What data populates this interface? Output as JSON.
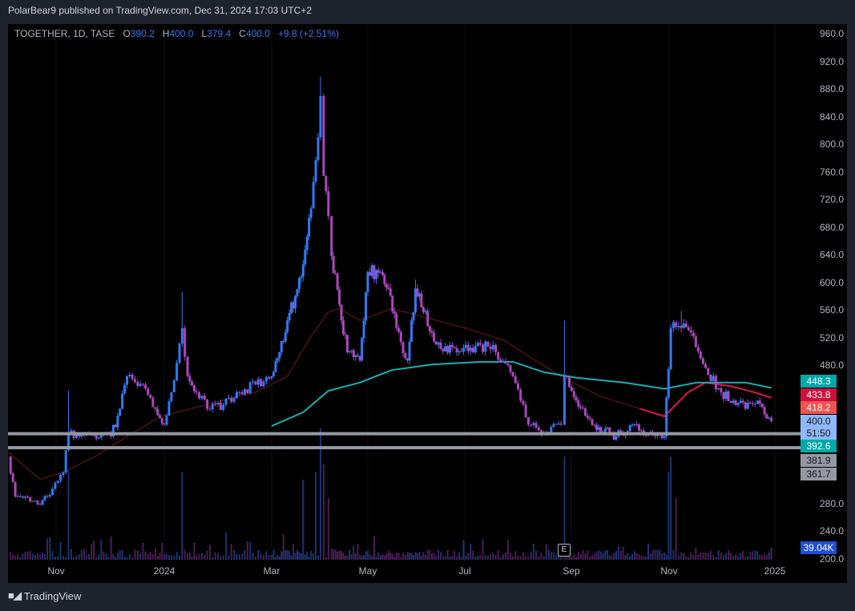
{
  "header": {
    "published": "PolarBear9 published on TradingView.com, Dec 31, 2024 17:03 UTC+2"
  },
  "legend": {
    "symbol": "TOGETHER, 1D, TASE",
    "o_label": "O",
    "o": "390.2",
    "h_label": "H",
    "h": "400.0",
    "l_label": "L",
    "l": "379.4",
    "c_label": "C",
    "c": "400.0",
    "change": "+9.8 (+2.51%)"
  },
  "price_scale": [
    "960.0",
    "920.0",
    "880.0",
    "840.0",
    "800.0",
    "760.0",
    "720.0",
    "680.0",
    "640.0",
    "600.0",
    "560.0",
    "520.0",
    "480.0",
    "280.0",
    "240.0",
    "200.0"
  ],
  "price_tags": [
    {
      "text": "448.3",
      "bg": "#00a8a8",
      "fg": "#ffffff"
    },
    {
      "text": "433.8",
      "bg": "#d0103c",
      "fg": "#ffffff"
    },
    {
      "text": "418.2",
      "bg": "#f05350",
      "fg": "#ffffff"
    },
    {
      "text": "400.0",
      "bg": "#8fb8f8",
      "fg": "#131722"
    },
    {
      "text": "51:50",
      "bg": "#8fb8f8",
      "fg": "#131722"
    },
    {
      "text": "392.6",
      "bg": "#00a8a8",
      "fg": "#ffffff"
    },
    {
      "text": "381.9",
      "bg": "#9598a1",
      "fg": "#131722"
    },
    {
      "text": "361.7",
      "bg": "#9598a1",
      "fg": "#131722"
    },
    {
      "text": "39.04K",
      "bg": "#1e4fd6",
      "fg": "#ffffff"
    }
  ],
  "x_axis": [
    {
      "label": "Nov",
      "date": "2023-11-01"
    },
    {
      "label": "2024",
      "date": "2024-01-01"
    },
    {
      "label": "Mar",
      "date": "2024-03-01"
    },
    {
      "label": "May",
      "date": "2024-05-01"
    },
    {
      "label": "Jul",
      "date": "2024-07-01"
    },
    {
      "label": "Sep",
      "date": "2024-09-01"
    },
    {
      "label": "Nov",
      "date": "2024-11-01"
    },
    {
      "label": "2025",
      "date": "2025-01-01"
    }
  ],
  "earnings_marker": "E",
  "branding": {
    "logo_text": "TradingView",
    "logo_mark": "TV"
  },
  "colors": {
    "up": "#3179f5",
    "down": "#ab47bc",
    "ma_long": "#17b0b8",
    "ma_mid_early": "#4a1414",
    "ma_mid_late": "#e0154b",
    "hline": "#9598a1",
    "vol_up": "#1c3272",
    "vol_down": "#4a1d55"
  },
  "chart_data": {
    "type": "candlestick",
    "title": "TOGETHER, 1D, TASE",
    "ylim": [
      200,
      960
    ],
    "closes": [
      [
        "2023-10-05",
        349
      ],
      [
        "2023-10-09",
        291
      ],
      [
        "2023-10-23",
        279
      ],
      [
        "2023-10-27",
        291
      ],
      [
        "2023-11-05",
        326
      ],
      [
        "2023-11-08",
        384
      ],
      [
        "2023-11-14",
        378
      ],
      [
        "2023-12-02",
        378
      ],
      [
        "2023-12-07",
        418
      ],
      [
        "2023-12-11",
        465
      ],
      [
        "2023-12-20",
        453
      ],
      [
        "2023-12-27",
        418
      ],
      [
        "2024-01-01",
        395
      ],
      [
        "2024-01-05",
        442
      ],
      [
        "2024-01-11",
        535
      ],
      [
        "2024-01-14",
        465
      ],
      [
        "2024-01-19",
        442
      ],
      [
        "2024-01-25",
        418
      ],
      [
        "2024-02-03",
        424
      ],
      [
        "2024-02-12",
        442
      ],
      [
        "2024-02-21",
        453
      ],
      [
        "2024-03-01",
        465
      ],
      [
        "2024-03-06",
        500
      ],
      [
        "2024-03-11",
        546
      ],
      [
        "2024-03-16",
        581
      ],
      [
        "2024-03-21",
        627
      ],
      [
        "2024-03-26",
        708
      ],
      [
        "2024-03-29",
        778
      ],
      [
        "2024-04-01",
        871
      ],
      [
        "2024-04-03",
        755
      ],
      [
        "2024-04-06",
        697
      ],
      [
        "2024-04-08",
        639
      ],
      [
        "2024-04-13",
        569
      ],
      [
        "2024-04-18",
        500
      ],
      [
        "2024-04-26",
        488
      ],
      [
        "2024-05-01",
        616
      ],
      [
        "2024-05-09",
        616
      ],
      [
        "2024-05-14",
        592
      ],
      [
        "2024-05-19",
        535
      ],
      [
        "2024-05-26",
        488
      ],
      [
        "2024-05-31",
        592
      ],
      [
        "2024-06-05",
        558
      ],
      [
        "2024-06-13",
        511
      ],
      [
        "2024-06-26",
        500
      ],
      [
        "2024-07-10",
        511
      ],
      [
        "2024-07-19",
        500
      ],
      [
        "2024-07-29",
        465
      ],
      [
        "2024-08-07",
        395
      ],
      [
        "2024-08-16",
        384
      ],
      [
        "2024-08-26",
        395
      ],
      [
        "2024-08-28",
        465
      ],
      [
        "2024-09-04",
        430
      ],
      [
        "2024-09-14",
        395
      ],
      [
        "2024-09-29",
        378
      ],
      [
        "2024-10-09",
        395
      ],
      [
        "2024-10-19",
        384
      ],
      [
        "2024-10-29",
        378
      ],
      [
        "2024-11-02",
        535
      ],
      [
        "2024-11-08",
        535
      ],
      [
        "2024-11-15",
        523
      ],
      [
        "2024-11-22",
        477
      ],
      [
        "2024-12-01",
        442
      ],
      [
        "2024-12-15",
        418
      ],
      [
        "2024-12-22",
        430
      ],
      [
        "2024-12-30",
        400
      ]
    ],
    "wick_highs": [
      [
        "2023-11-08",
        444
      ],
      [
        "2024-01-11",
        587
      ],
      [
        "2024-04-01",
        899
      ],
      [
        "2024-08-28",
        546
      ],
      [
        "2024-11-08",
        560
      ],
      [
        "2024-05-31",
        605
      ]
    ],
    "ma_long": [
      [
        "2024-03-01",
        393
      ],
      [
        "2024-03-21",
        413
      ],
      [
        "2024-04-06",
        444
      ],
      [
        "2024-04-26",
        456
      ],
      [
        "2024-05-16",
        474
      ],
      [
        "2024-06-10",
        482
      ],
      [
        "2024-07-10",
        486
      ],
      [
        "2024-07-29",
        486
      ],
      [
        "2024-08-16",
        471
      ],
      [
        "2024-09-04",
        463
      ],
      [
        "2024-10-04",
        456
      ],
      [
        "2024-10-29",
        447
      ],
      [
        "2024-11-17",
        456
      ],
      [
        "2024-12-15",
        456
      ],
      [
        "2024-12-30",
        448.3
      ]
    ],
    "ma_mid": [
      [
        "2023-10-05",
        355
      ],
      [
        "2023-10-23",
        316
      ],
      [
        "2023-11-05",
        326
      ],
      [
        "2023-11-23",
        349
      ],
      [
        "2023-12-11",
        378
      ],
      [
        "2023-12-30",
        407
      ],
      [
        "2024-01-25",
        424
      ],
      [
        "2024-02-21",
        442
      ],
      [
        "2024-03-11",
        465
      ],
      [
        "2024-03-26",
        523
      ],
      [
        "2024-04-06",
        558
      ],
      [
        "2024-04-13",
        563
      ],
      [
        "2024-04-26",
        546
      ],
      [
        "2024-05-16",
        563
      ],
      [
        "2024-06-05",
        551
      ],
      [
        "2024-07-01",
        535
      ],
      [
        "2024-07-24",
        517
      ],
      [
        "2024-08-07",
        494
      ],
      [
        "2024-08-26",
        465
      ],
      [
        "2024-09-19",
        436
      ],
      [
        "2024-10-14",
        418
      ],
      [
        "2024-10-29",
        407
      ],
      [
        "2024-11-12",
        442
      ],
      [
        "2024-11-22",
        456
      ],
      [
        "2024-12-06",
        451
      ],
      [
        "2024-12-20",
        442
      ],
      [
        "2024-12-30",
        433.8
      ]
    ],
    "ma_mid_color_switch": "2024-10-20",
    "horizontal_lines": [
      381.9,
      361.7
    ],
    "volume_last_k": 39.04,
    "volume_spikes_k": [
      [
        "2023-11-08",
        290
      ],
      [
        "2024-01-11",
        285
      ],
      [
        "2024-03-21",
        260
      ],
      [
        "2024-03-29",
        285
      ],
      [
        "2024-04-01",
        427
      ],
      [
        "2024-04-03",
        310
      ],
      [
        "2024-04-06",
        200
      ],
      [
        "2024-08-28",
        335
      ],
      [
        "2024-11-01",
        285
      ],
      [
        "2024-11-02",
        335
      ],
      [
        "2024-11-05",
        200
      ]
    ]
  }
}
